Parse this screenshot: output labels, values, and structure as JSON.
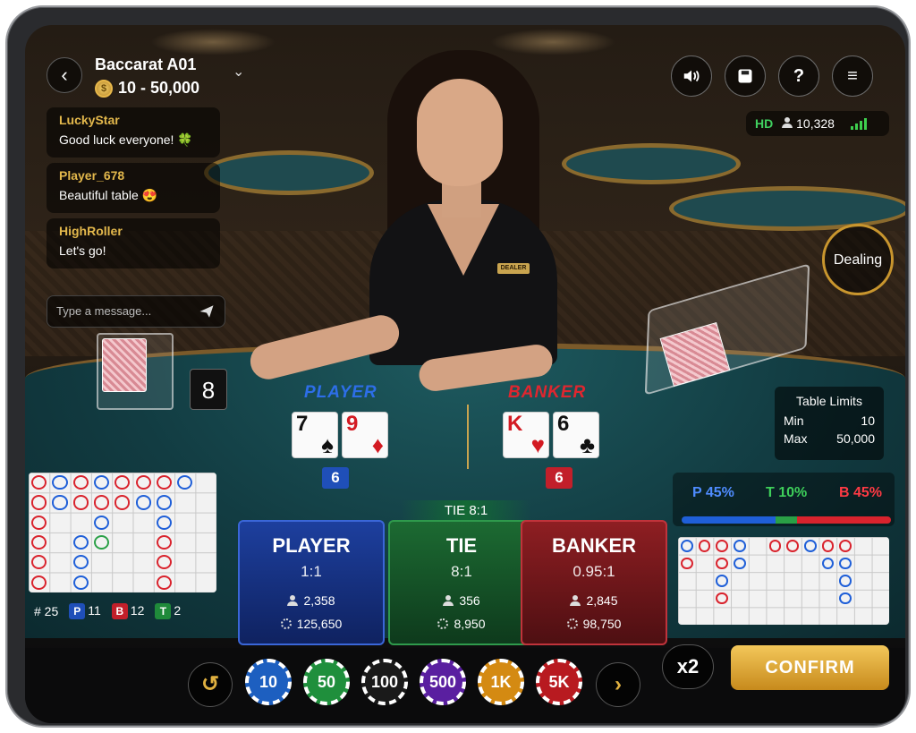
{
  "header": {
    "table_name": "Baccarat A01",
    "bet_range": "10 - 50,000",
    "quality": "HD",
    "viewers": "10,328"
  },
  "chat": {
    "messages": [
      {
        "user": "LuckyStar",
        "text": "Good luck everyone! 🍀"
      },
      {
        "user": "Player_678",
        "text": "Beautiful table 😍"
      },
      {
        "user": "HighRoller",
        "text": "Let's go!"
      }
    ],
    "placeholder": "Type a message..."
  },
  "status": {
    "dealing": "Dealing"
  },
  "dealer_badge": "DEALER",
  "card_count": "8",
  "table_limits": {
    "title": "Table Limits",
    "min_label": "Min",
    "min_value": "10",
    "max_label": "Max",
    "max_value": "50,000"
  },
  "hands": {
    "player": {
      "label": "PLAYER",
      "score": "6",
      "cards": [
        {
          "rank": "7",
          "suit": "♠"
        },
        {
          "rank": "9",
          "suit": "♦"
        }
      ]
    },
    "banker": {
      "label": "BANKER",
      "score": "6",
      "cards": [
        {
          "rank": "K",
          "suit": "♥"
        },
        {
          "rank": "6",
          "suit": "♣"
        }
      ]
    }
  },
  "road_stats": {
    "rounds": "# 25",
    "player_count": "11",
    "banker_count": "12",
    "tie_count": "2",
    "p_tag": "P",
    "b_tag": "B",
    "t_tag": "T"
  },
  "percentages": {
    "player": "P 45%",
    "tie": "T 10%",
    "banker": "B 45%",
    "player_value": 45,
    "tie_value": 10,
    "banker_value": 45
  },
  "tie_banner": "TIE 8:1",
  "bets": [
    {
      "name": "PLAYER",
      "odds": "1:1",
      "players": "2,358",
      "amount": "125,650"
    },
    {
      "name": "TIE",
      "odds": "8:1",
      "players": "356",
      "amount": "8,950"
    },
    {
      "name": "BANKER",
      "odds": "0.95:1",
      "players": "2,845",
      "amount": "98,750"
    }
  ],
  "chips": [
    "10",
    "50",
    "100",
    "500",
    "1K",
    "5K"
  ],
  "controls": {
    "double": "x2",
    "confirm": "CONFIRM"
  },
  "colors": {
    "player": "#1f4fb8",
    "banker": "#c21f2a",
    "tie": "#1f8a3a",
    "gold": "#e0b040"
  }
}
